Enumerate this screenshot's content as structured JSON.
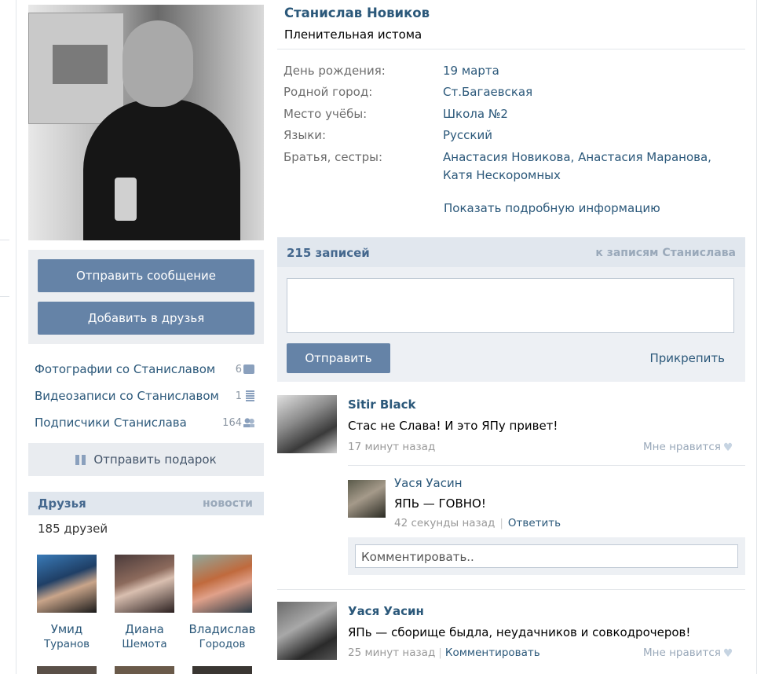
{
  "profile": {
    "name": "Станислав Новиков",
    "status": "Пленительная истома",
    "info": [
      {
        "key": "День рождения:",
        "value": "19 марта"
      },
      {
        "key": "Родной город:",
        "value": "Ст.Багаевская"
      },
      {
        "key": "Место учёбы:",
        "value": "Школа №2"
      },
      {
        "key": "Языки:",
        "value": "Русский"
      },
      {
        "key": "Братья, сестры:",
        "value": "Анастасия Новикова, Анастасия Маранова,",
        "value2": "Катя Нескоромных"
      }
    ],
    "show_more": "Показать подробную информацию"
  },
  "actions": {
    "send_message": "Отправить сообщение",
    "add_friend": "Добавить в друзья",
    "send_gift": "Отправить подарок"
  },
  "side_links": [
    {
      "label": "Фотографии со Станиславом",
      "count": "6",
      "icon": "camera-icon"
    },
    {
      "label": "Видеозаписи со Станиславом",
      "count": "1",
      "icon": "film-icon"
    },
    {
      "label": "Подписчики Станислава",
      "count": "164",
      "icon": "people-icon"
    }
  ],
  "friends": {
    "title": "Друзья",
    "news_link": "новости",
    "count": "185 друзей",
    "list": [
      {
        "first": "Умид",
        "last": "Туранов"
      },
      {
        "first": "Диана",
        "last": "Шемота"
      },
      {
        "first": "Владислав",
        "last": "Городов"
      }
    ]
  },
  "wall": {
    "count": "215 записей",
    "to_posts": "к записям Станислава",
    "send": "Отправить",
    "attach": "Прикрепить",
    "posts": [
      {
        "author": "Sitir Black",
        "text": "Стас не Слава! И это ЯПу привет!",
        "time": "17 минут назад",
        "like": "Мне нравится",
        "comments": [
          {
            "author": "Уася Уасин",
            "text": "ЯПЬ — ГОВНО!",
            "time": "42 секунды назад",
            "reply": "Ответить"
          }
        ],
        "comment_placeholder": "Комментировать.."
      },
      {
        "author": "Уася Уасин",
        "text": "ЯПь — сборище быдла, неудачников и совкодрочеров!",
        "time": "25 минут назад",
        "comment_link": "Комментировать",
        "like": "Мне нравится"
      }
    ]
  },
  "colors": {
    "link": "#2b587a",
    "button": "#6583a7",
    "header_bg": "#e1e7ee",
    "panel_bg": "#edf0f4"
  }
}
